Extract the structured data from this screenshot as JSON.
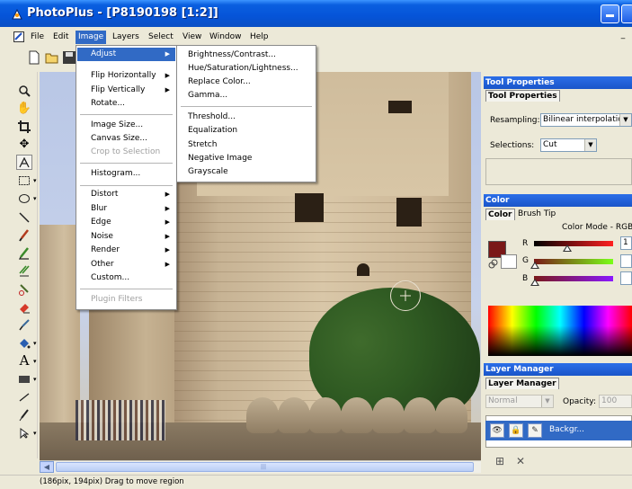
{
  "window": {
    "title": "PhotoPlus - [P8190198 [1:2]]"
  },
  "menubar": {
    "items": [
      "File",
      "Edit",
      "Image",
      "Layers",
      "Select",
      "View",
      "Window",
      "Help"
    ],
    "active": "Image",
    "mdi_min": "_"
  },
  "image_menu": {
    "items": [
      {
        "label": "Adjust",
        "submenu": true,
        "highlighted": true
      },
      {
        "label": "Flip Horizontally",
        "submenu": true
      },
      {
        "label": "Flip Vertically",
        "submenu": true
      },
      {
        "label": "Rotate..."
      },
      {
        "label": "Image Size..."
      },
      {
        "label": "Canvas Size..."
      },
      {
        "label": "Crop to Selection",
        "disabled": true
      },
      {
        "label": "Histogram..."
      },
      {
        "label": "Distort",
        "submenu": true
      },
      {
        "label": "Blur",
        "submenu": true
      },
      {
        "label": "Edge",
        "submenu": true
      },
      {
        "label": "Noise",
        "submenu": true
      },
      {
        "label": "Render",
        "submenu": true
      },
      {
        "label": "Other",
        "submenu": true
      },
      {
        "label": "Custom..."
      },
      {
        "label": "Plugin Filters",
        "disabled": true
      }
    ]
  },
  "adjust_menu": {
    "items": [
      "Brightness/Contrast...",
      "Hue/Saturation/Lightness...",
      "Replace Color...",
      "Gamma...",
      "Threshold...",
      "Equalization",
      "Stretch",
      "Negative Image",
      "Grayscale"
    ]
  },
  "tool_properties": {
    "header": "Tool Properties",
    "tab": "Tool Properties",
    "resampling_label": "Resampling:",
    "resampling_value": "Bilinear interpolation",
    "selections_label": "Selections:",
    "selections_value": "Cut"
  },
  "color_panel": {
    "header": "Color",
    "tabs": [
      "Color",
      "Brush Tip"
    ],
    "mode_label": "Color Mode - RGB",
    "channels": [
      {
        "name": "R",
        "value": "1"
      },
      {
        "name": "G",
        "value": ""
      },
      {
        "name": "B",
        "value": ""
      }
    ],
    "foreground": "#7a1818",
    "background": "#ffffff"
  },
  "layer_manager": {
    "header": "Layer Manager",
    "tab": "Layer Manager",
    "blend_mode": "Normal",
    "opacity_label": "Opacity:",
    "opacity_value": "100",
    "layer_name": "Backgr..."
  },
  "status": {
    "text": "(186pix, 194pix)  Drag to move region"
  },
  "colors": {
    "selection": "#316ac5",
    "title_blue": "#0554d8",
    "panel_head": "#2b6ee8"
  }
}
